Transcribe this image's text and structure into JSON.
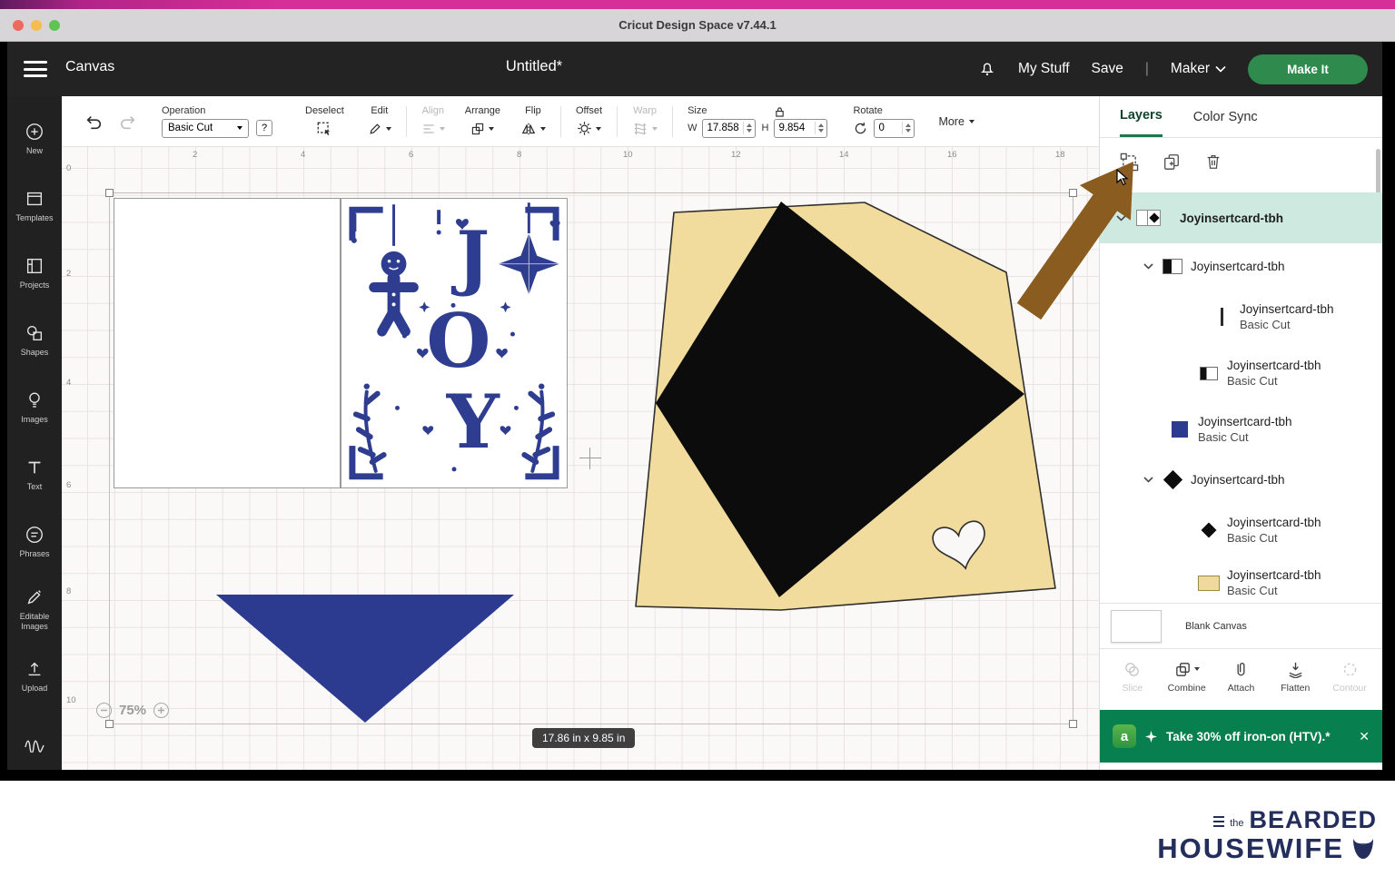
{
  "window": {
    "title": "Cricut Design Space  v7.44.1"
  },
  "header": {
    "canvas_label": "Canvas",
    "doc_title": "Untitled*",
    "my_stuff": "My Stuff",
    "save": "Save",
    "divider": "|",
    "machine": "Maker",
    "make_it": "Make It"
  },
  "sidebar": {
    "items": [
      "New",
      "Templates",
      "Projects",
      "Shapes",
      "Images",
      "Text",
      "Phrases",
      "Editable Images",
      "Upload"
    ]
  },
  "toolbar": {
    "operation_label": "Operation",
    "operation_value": "Basic Cut",
    "help": "?",
    "deselect": "Deselect",
    "edit": "Edit",
    "align": "Align",
    "arrange": "Arrange",
    "flip": "Flip",
    "offset": "Offset",
    "warp": "Warp",
    "size_label": "Size",
    "w_label": "W",
    "w_value": "17.858",
    "h_label": "H",
    "h_value": "9.854",
    "rotate_label": "Rotate",
    "rotate_value": "0",
    "more_label": "More"
  },
  "canvas": {
    "h_ticks": [
      "2",
      "4",
      "6",
      "8",
      "10",
      "12",
      "14",
      "16",
      "18"
    ],
    "v_ticks": [
      "0",
      "2",
      "4",
      "6",
      "8",
      "10"
    ],
    "zoom_level": "75%",
    "selection_size": "17.86 in x 9.85 in",
    "joy_letters": [
      "J",
      "O",
      "Y"
    ]
  },
  "layers": {
    "tab_layers": "Layers",
    "tab_color_sync": "Color Sync",
    "rows": [
      {
        "name": "Joyinsertcard-tbh",
        "sub": ""
      },
      {
        "name": "Joyinsertcard-tbh",
        "sub": ""
      },
      {
        "name": "Joyinsertcard-tbh",
        "sub": "Basic Cut"
      },
      {
        "name": "Joyinsertcard-tbh",
        "sub": "Basic Cut"
      },
      {
        "name": "Joyinsertcard-tbh",
        "sub": "Basic Cut"
      },
      {
        "name": "Joyinsertcard-tbh",
        "sub": ""
      },
      {
        "name": "Joyinsertcard-tbh",
        "sub": "Basic Cut"
      },
      {
        "name": "Joyinsertcard-tbh",
        "sub": "Basic Cut"
      }
    ],
    "blank_canvas_label": "Blank Canvas",
    "actions": [
      "Slice",
      "Combine",
      "Attach",
      "Flatten",
      "Contour"
    ],
    "banner": {
      "badge": "a",
      "text": "Take 30% off iron-on (HTV).*",
      "close": "✕"
    }
  },
  "footer_logo": {
    "the": "the",
    "line1": "BEARDED",
    "line2": "HOUSEWIFE"
  }
}
